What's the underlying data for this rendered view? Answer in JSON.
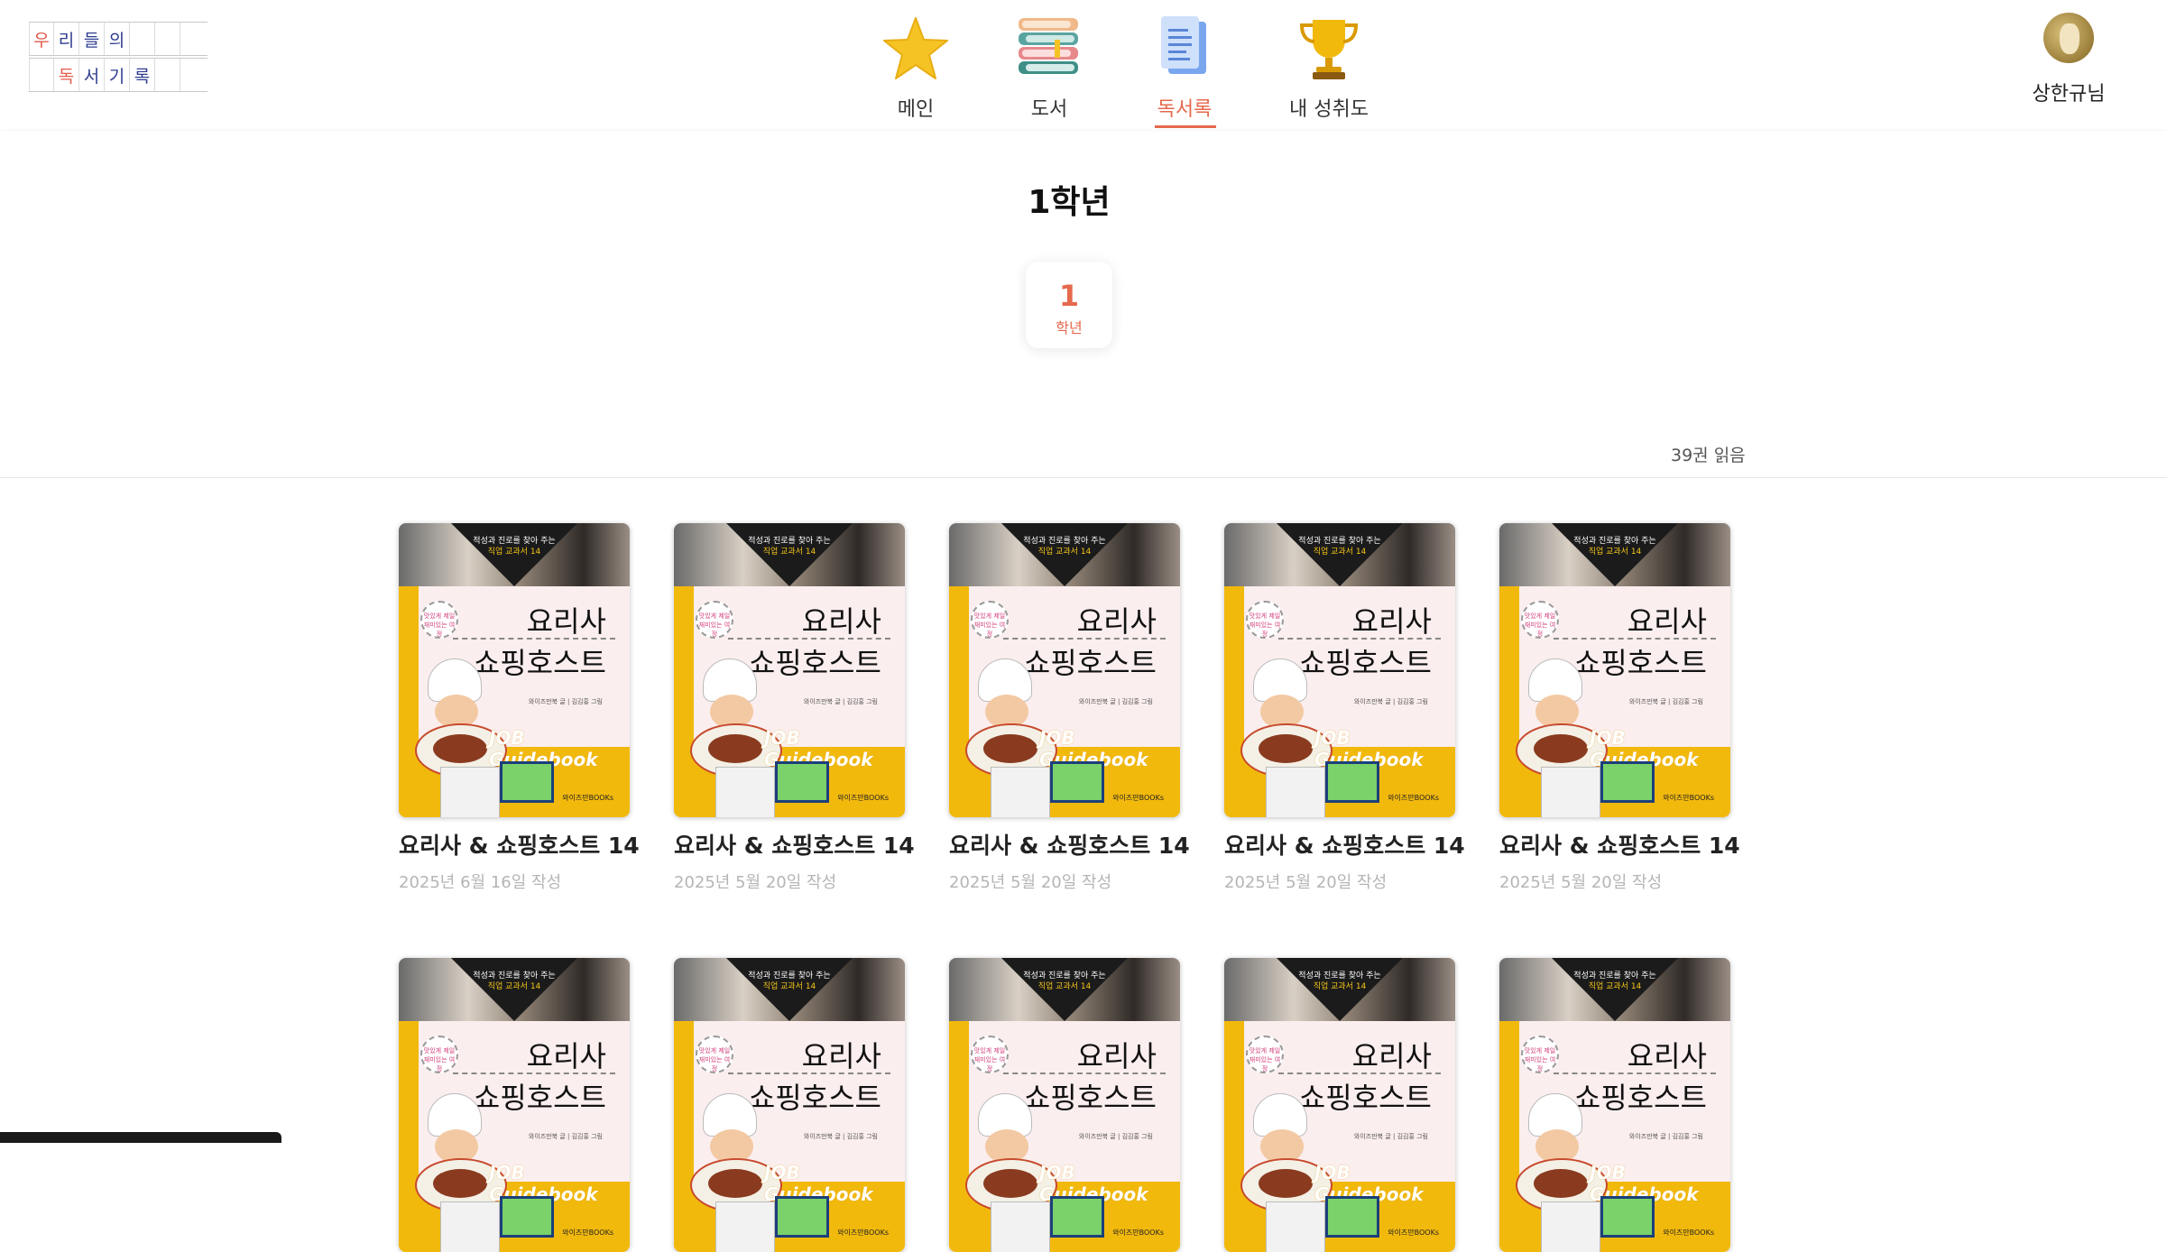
{
  "logo": {
    "row1": [
      "우",
      "리",
      "들",
      "의",
      "",
      ""
    ],
    "row2": [
      "",
      "독",
      "서",
      "기",
      "록",
      ""
    ]
  },
  "nav": {
    "items": [
      {
        "label": "메인",
        "icon": "star-icon"
      },
      {
        "label": "도서",
        "icon": "books-stack-icon"
      },
      {
        "label": "독서록",
        "icon": "document-icon",
        "active": true
      },
      {
        "label": "내 성취도",
        "icon": "trophy-icon"
      }
    ]
  },
  "user": {
    "name": "상한규님",
    "avatar_icon": "avatar-icon"
  },
  "grade": {
    "title": "1학년",
    "selected_number": "1",
    "selected_unit": "학년",
    "read_count": "39권 읽음"
  },
  "books": [
    {
      "title": "요리사 & 쇼핑호스트 14",
      "date": "2025년 6월 16일 작성"
    },
    {
      "title": "요리사 & 쇼핑호스트 14",
      "date": "2025년 5월 20일 작성"
    },
    {
      "title": "요리사 & 쇼핑호스트 14",
      "date": "2025년 5월 20일 작성"
    },
    {
      "title": "요리사 & 쇼핑호스트 14",
      "date": "2025년 5월 20일 작성"
    },
    {
      "title": "요리사 & 쇼핑호스트 14",
      "date": "2025년 5월 20일 작성"
    },
    {
      "title": "",
      "date": ""
    },
    {
      "title": "",
      "date": ""
    },
    {
      "title": "",
      "date": ""
    },
    {
      "title": "",
      "date": ""
    },
    {
      "title": "",
      "date": ""
    }
  ],
  "cover": {
    "tagline_1": "적성과 진로를 찾아 주는",
    "tagline_2": "직업 교과서 14",
    "title_1": "요리사",
    "title_2": "쇼핑호스트",
    "series": "JOB Guidebook",
    "badge": "맛있게 제일 재미있는 여정",
    "author": "와이즈만북 글 | 김김홍 그림",
    "publisher": "와이즈만BOOKs"
  },
  "colors": {
    "accent": "#e5694d",
    "cover_yellow": "#f2b90d"
  }
}
